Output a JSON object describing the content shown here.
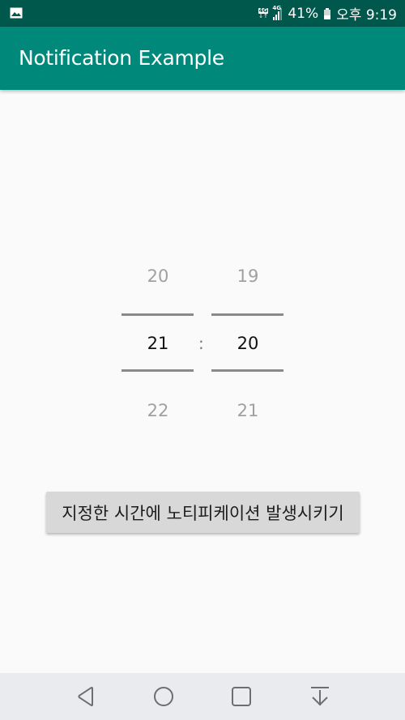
{
  "status_bar": {
    "left_icon": "gallery-icon",
    "network_type": "4G",
    "signal_label": "4G",
    "signal_strength_bars": 3,
    "signal_max_bars": 4,
    "battery_percent_text": "41%",
    "battery_level": 0.41,
    "time": "오후 9:19"
  },
  "app_bar": {
    "title": "Notification Example"
  },
  "time_picker": {
    "separator": ":",
    "hour": {
      "previous": "20",
      "current": "21",
      "next": "22"
    },
    "minute": {
      "previous": "19",
      "current": "20",
      "next": "21"
    }
  },
  "action_button": {
    "label": "지정한 시간에 노티피케이션 발생시키기"
  },
  "nav_bar": {
    "buttons": [
      {
        "name": "back",
        "icon": "back-triangle-icon"
      },
      {
        "name": "home",
        "icon": "home-circle-icon"
      },
      {
        "name": "recent",
        "icon": "recent-apps-square-icon"
      },
      {
        "name": "notification-pull",
        "icon": "arrow-down-bar-icon"
      }
    ]
  },
  "colors": {
    "status_bar": "#00574b",
    "app_bar": "#00897b",
    "background": "#fafafa",
    "button": "#d8d8d8",
    "nav_bar": "#eaebef"
  }
}
